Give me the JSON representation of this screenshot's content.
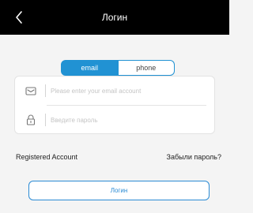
{
  "header": {
    "title": "Логин",
    "back_icon": "chevron-left-icon"
  },
  "tabs": [
    {
      "label": "email",
      "selected": true
    },
    {
      "label": "phone",
      "selected": false
    }
  ],
  "form": {
    "email": {
      "icon": "envelope-icon",
      "value": "",
      "placeholder": "Please enter your email account"
    },
    "password": {
      "icon": "lock-icon",
      "value": "",
      "placeholder": "Введите пароль"
    }
  },
  "links": {
    "register": "Registered Account",
    "forgot": "Забыли пароль?"
  },
  "login_button": "Логин",
  "colors": {
    "accent": "#2192d3",
    "header_bg": "#000000",
    "page_bg": "#f4f4f4"
  }
}
